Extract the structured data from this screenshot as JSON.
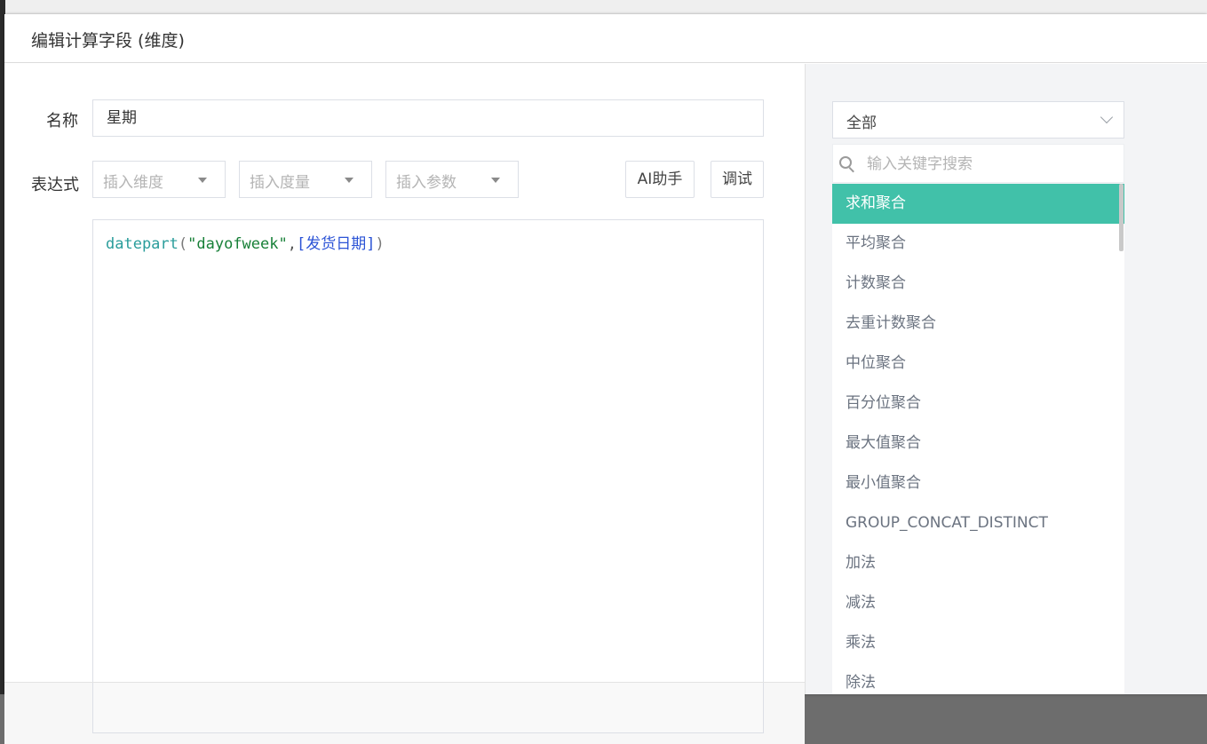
{
  "dialog": {
    "title": "编辑计算字段 (维度)"
  },
  "form": {
    "name_label": "名称",
    "name_value": "星期",
    "expression_label": "表达式",
    "insert_dimension": "插入维度",
    "insert_measure": "插入度量",
    "insert_param": "插入参数",
    "ai_button": "AI助手",
    "debug_button": "调试"
  },
  "expression": {
    "fn": "datepart",
    "open": "(",
    "arg_string": "\"dayofweek\"",
    "comma": ",",
    "field": "[发货日期]",
    "close": ")"
  },
  "functions": {
    "category": "全部",
    "search_placeholder": "输入关键字搜索",
    "items": [
      "求和聚合",
      "平均聚合",
      "计数聚合",
      "去重计数聚合",
      "中位聚合",
      "百分位聚合",
      "最大值聚合",
      "最小值聚合",
      "GROUP_CONCAT_DISTINCT",
      "加法",
      "减法",
      "乘法",
      "除法"
    ],
    "active_index": 0,
    "active_color": "#41c1a9"
  }
}
